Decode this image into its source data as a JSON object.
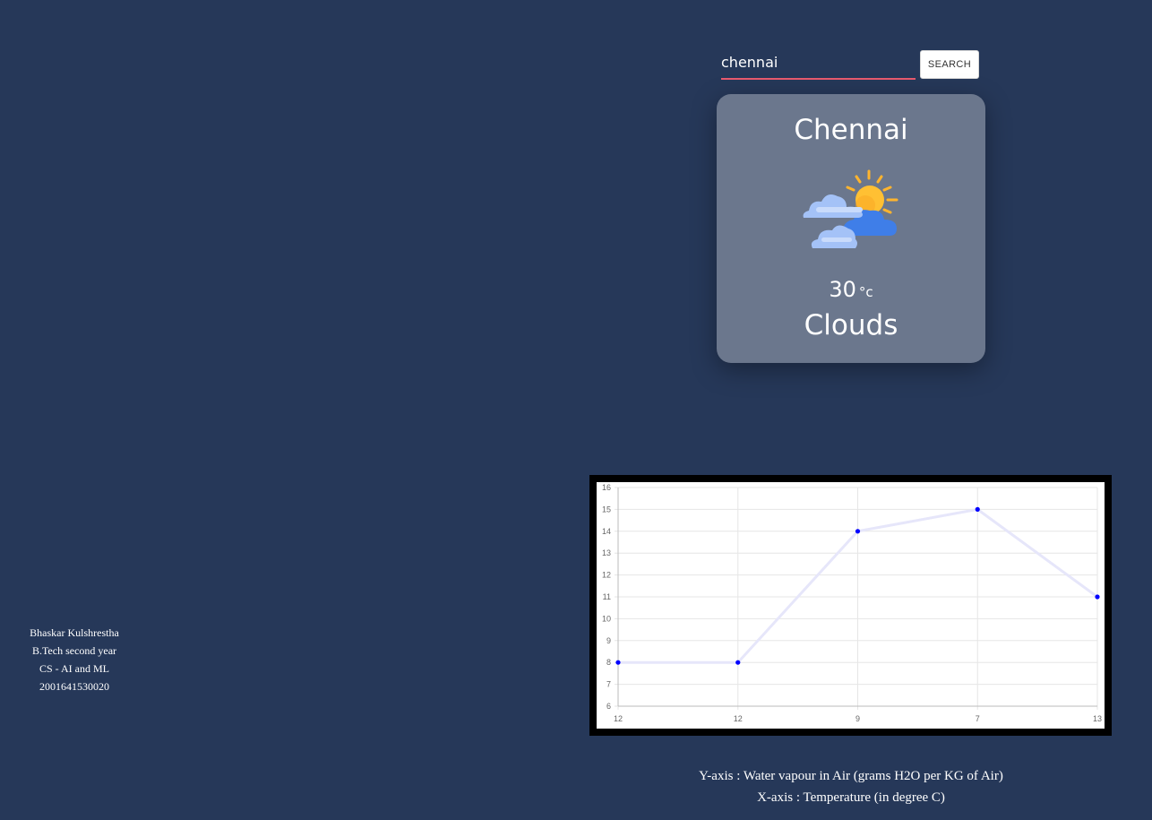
{
  "search": {
    "value": "chennai",
    "button_label": "SEARCH"
  },
  "weather": {
    "city": "Chennai",
    "icon": "partly-cloudy-icon",
    "temperature": "30",
    "unit": "°c",
    "condition": "Clouds"
  },
  "author": {
    "name": "Bhaskar Kulshrestha",
    "course": "B.Tech second year",
    "branch": "CS - AI and ML",
    "roll": "2001641530020"
  },
  "captions": {
    "y_axis": "Y-axis : Water vapour in Air (grams H2O per KG of Air)",
    "x_axis": "X-axis : Temperature (in degree C)"
  },
  "colors": {
    "background": "#263859",
    "card": "#6b778d",
    "search_underline": "#e85a6e",
    "line": "#e6e6fa",
    "point": "#0000ff"
  },
  "chart_data": {
    "type": "line",
    "categories": [
      "12",
      "12",
      "9",
      "7",
      "13"
    ],
    "values": [
      8,
      8,
      14,
      15,
      11
    ],
    "ylim": [
      6,
      16
    ],
    "yticks": [
      6,
      7,
      8,
      9,
      10,
      11,
      12,
      13,
      14,
      15,
      16
    ],
    "grid": true,
    "legend": "none"
  }
}
